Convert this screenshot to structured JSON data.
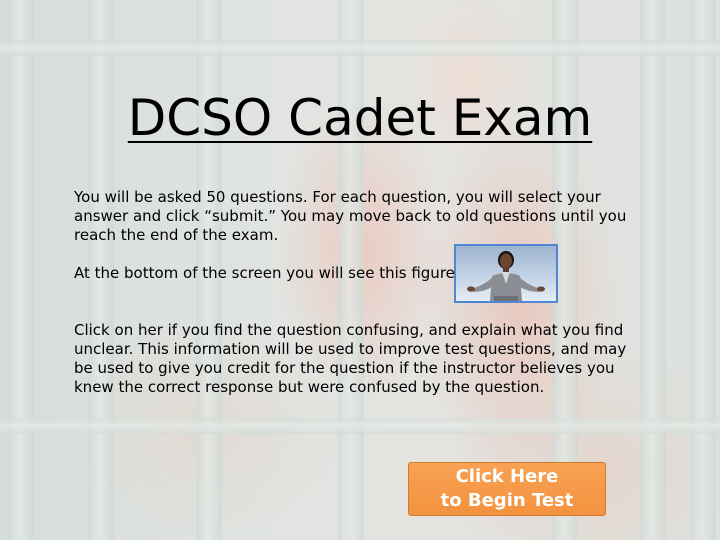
{
  "page": {
    "title": "DCSO Cadet Exam",
    "paragraph_1": "You will be asked 50 questions.  For each question, you will select your answer and click “submit.”  You may move back to old questions until you reach the end of the exam.",
    "paragraph_2": "At the bottom of the screen you will see this figure:",
    "paragraph_3": "Click on her if you find the question confusing, and explain what you find unclear.  This information will be used to improve test questions, and may be used to give you credit for the question if the instructor believes you knew the correct response but were confused by the question."
  },
  "figure": {
    "icon": "confused-woman-figure",
    "border_color": "#4f86d6"
  },
  "begin_button": {
    "line_1": "Click Here",
    "line_2": "to Begin Test",
    "color": "#f59a4a"
  }
}
